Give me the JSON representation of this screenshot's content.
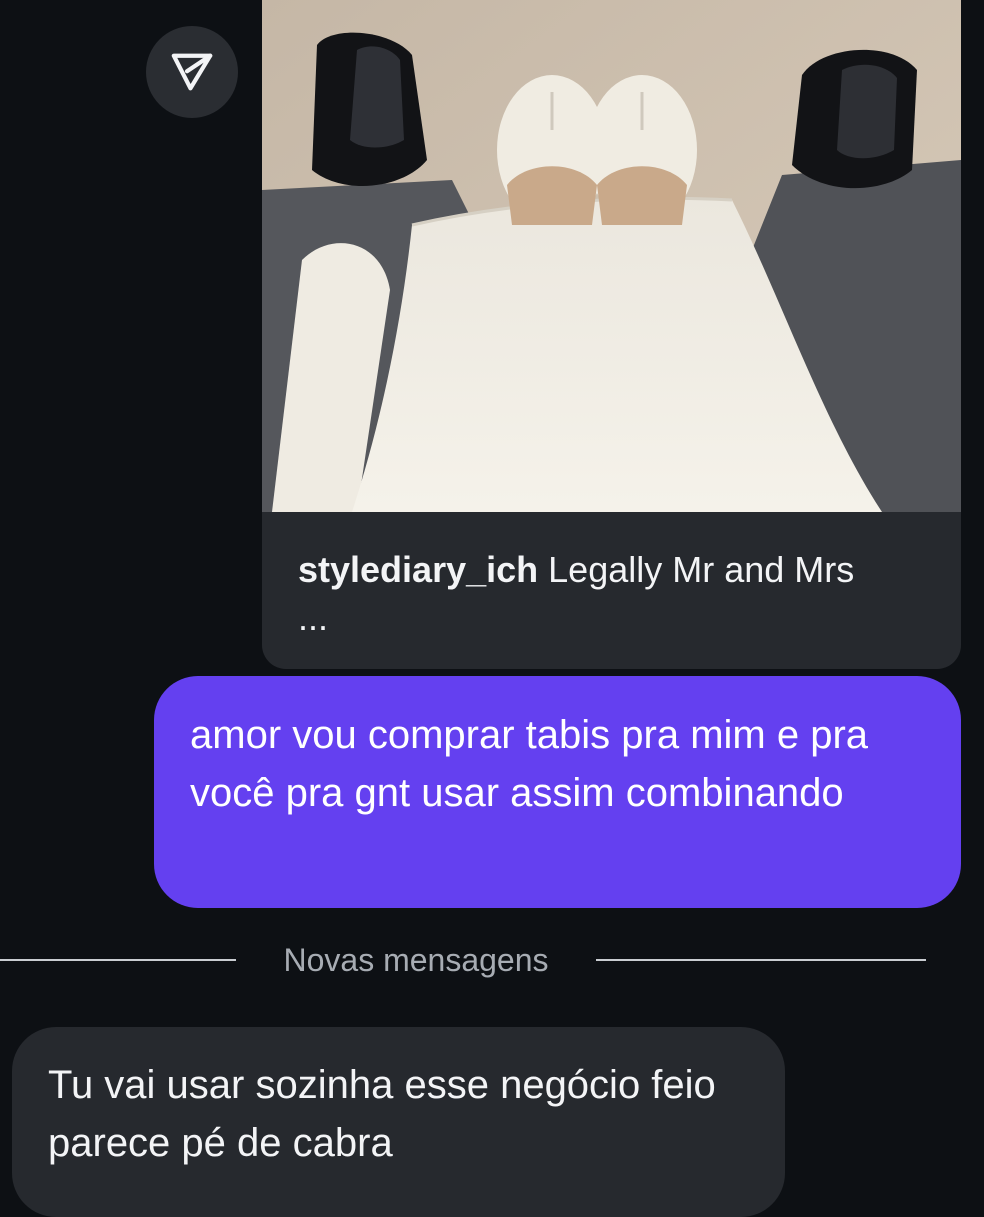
{
  "shared_post": {
    "username": "stylediary_ich",
    "caption": "Legally Mr and Mrs ...",
    "image_icon": "photo-feet-in-tabi-shoes"
  },
  "share_icon": "paper-plane-icon",
  "messages": [
    {
      "direction": "sent",
      "text": "amor vou comprar tabis pra mim e pra você pra gnt usar assim combinando"
    },
    {
      "direction": "received",
      "text": "Tu vai usar sozinha esse negócio feio parece pé de cabra"
    }
  ],
  "new_messages_divider": "Novas mensagens",
  "colors": {
    "background": "#0d1014",
    "sent_bubble": "#6440f0",
    "received_bubble": "#26292e"
  }
}
